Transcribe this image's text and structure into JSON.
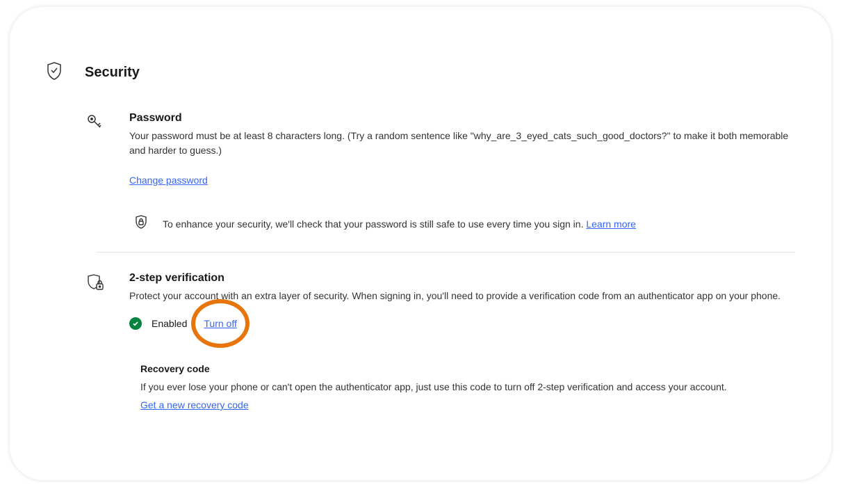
{
  "header": {
    "title": "Security"
  },
  "password": {
    "title": "Password",
    "desc": "Your password must be at least 8 characters long. (Try a random sentence like \"why_are_3_eyed_cats_such_good_doctors?\" to make it both memorable and harder to guess.)",
    "change_link": "Change password",
    "note_text": "To enhance your security, we'll check that your password is still safe to use every time you sign in. ",
    "learn_more": "Learn more"
  },
  "two_step": {
    "title": "2-step verification",
    "desc": "Protect your account with an extra layer of security. When signing in, you'll need to provide a verification code from an authenticator app on your phone.",
    "status_label": "Enabled",
    "turn_off_label": "Turn off",
    "recovery": {
      "title": "Recovery code",
      "desc": "If you ever lose your phone or can't open the authenticator app, just use this code to turn off 2-step verification and access your account.",
      "get_new_link": "Get a new recovery code"
    }
  }
}
